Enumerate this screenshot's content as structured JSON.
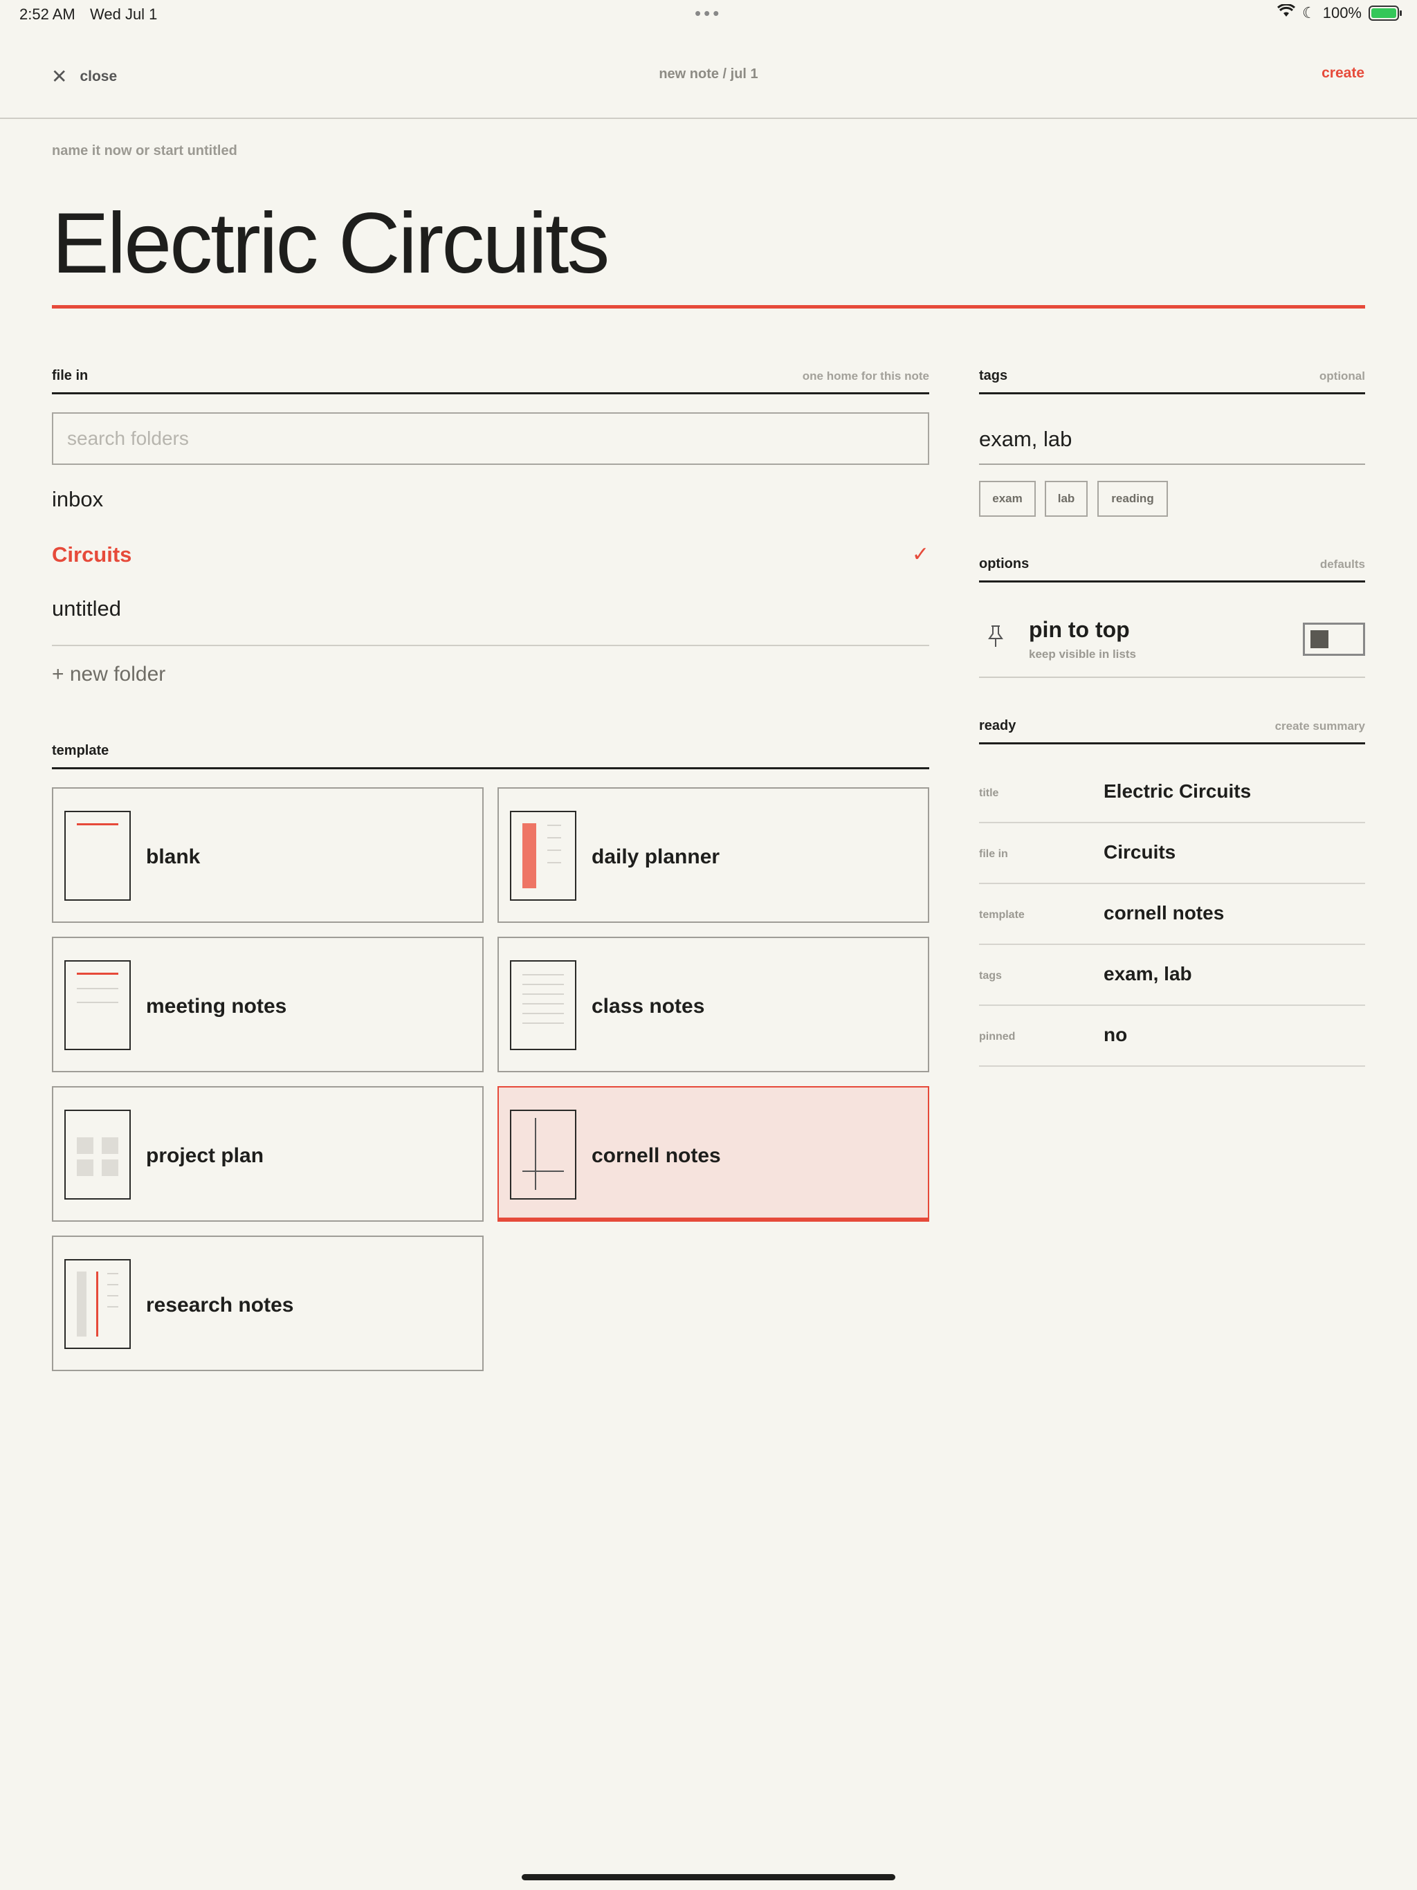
{
  "status_bar": {
    "time": "2:52 AM",
    "date": "Wed Jul 1",
    "dots": "•••",
    "battery_percent": "100%",
    "wifi_icon": "wifi-icon",
    "moon_icon": "moon-icon"
  },
  "nav": {
    "close_label": "close",
    "title": "new note / jul 1",
    "create_label": "create"
  },
  "note_title": {
    "eyebrow": "name it now or start untitled",
    "value": "Electric Circuits"
  },
  "file_in": {
    "label": "file in",
    "hint": "one home for this note",
    "search_placeholder": "search folders",
    "folders": [
      {
        "name": "inbox",
        "selected": false
      },
      {
        "name": "Circuits",
        "selected": true
      },
      {
        "name": "untitled",
        "selected": false
      }
    ],
    "check_glyph": "✓",
    "new_folder_label": "+ new folder"
  },
  "template": {
    "label": "template",
    "items": [
      {
        "name": "blank",
        "selected": false
      },
      {
        "name": "daily planner",
        "selected": false
      },
      {
        "name": "meeting notes",
        "selected": false
      },
      {
        "name": "class notes",
        "selected": false
      },
      {
        "name": "project plan",
        "selected": false
      },
      {
        "name": "cornell notes",
        "selected": true
      },
      {
        "name": "research notes",
        "selected": false
      }
    ]
  },
  "tags": {
    "label": "tags",
    "hint": "optional",
    "value": "exam, lab",
    "chips": [
      "exam",
      "lab",
      "reading"
    ]
  },
  "options": {
    "label": "options",
    "hint": "defaults",
    "pin_title": "pin to top",
    "pin_subtitle": "keep visible in lists",
    "pin_on": false
  },
  "summary": {
    "label": "ready",
    "hint": "create summary",
    "rows": [
      {
        "key": "title",
        "value": "Electric Circuits"
      },
      {
        "key": "file in",
        "value": "Circuits"
      },
      {
        "key": "template",
        "value": "cornell notes"
      },
      {
        "key": "tags",
        "value": "exam, lab"
      },
      {
        "key": "pinned",
        "value": "no"
      }
    ]
  },
  "colors": {
    "accent": "#e64a3a",
    "background": "#f6f5ef",
    "selected_card": "#f6e3dd"
  }
}
